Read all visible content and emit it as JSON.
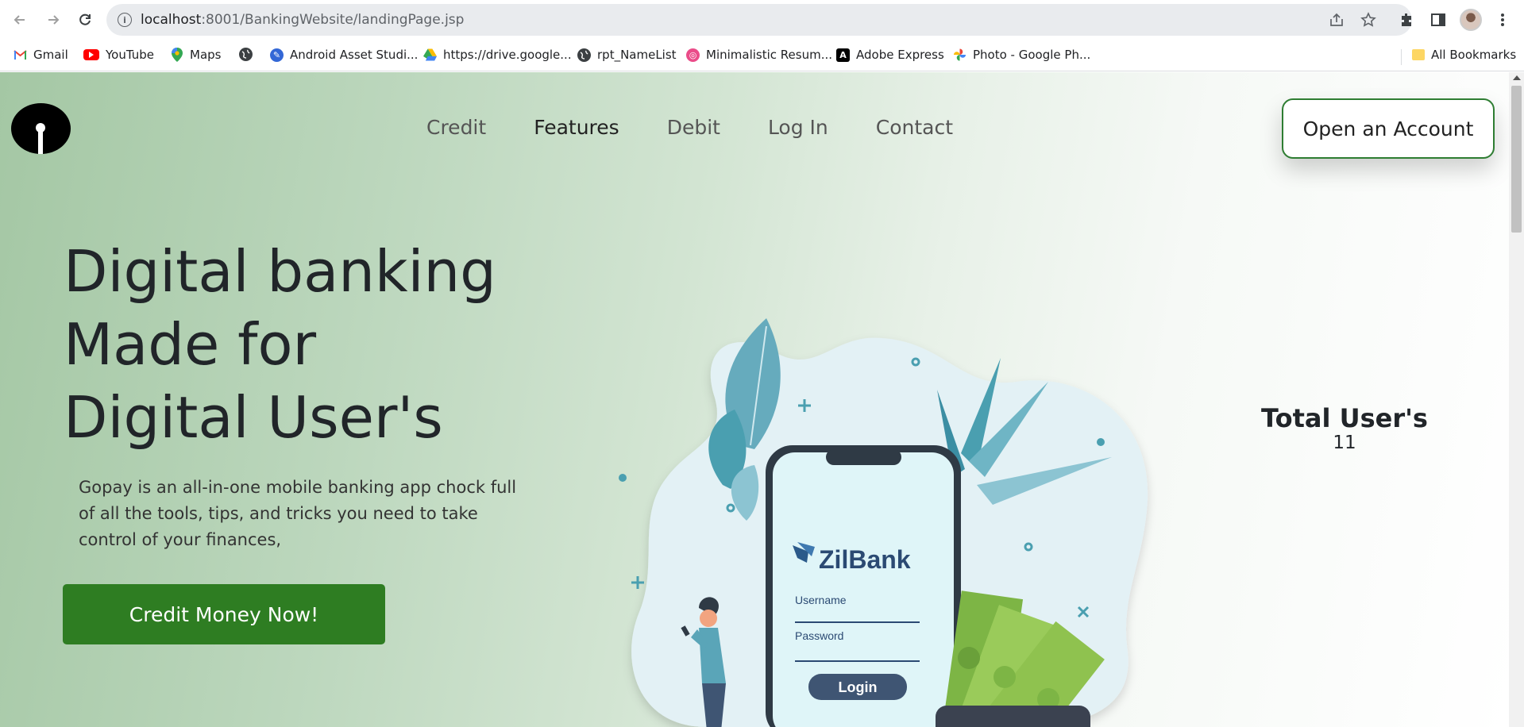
{
  "browser": {
    "url_host": "localhost",
    "url_rest": ":8001/BankingWebsite/landingPage.jsp",
    "bookmarks": [
      {
        "label": "Gmail",
        "icon": "gmail-icon",
        "color": "#ea4335"
      },
      {
        "label": "YouTube",
        "icon": "youtube-icon",
        "color": "#ff0000"
      },
      {
        "label": "Maps",
        "icon": "maps-icon",
        "color": "#34a853"
      },
      {
        "label": "",
        "icon": "globe-icon",
        "color": "#3c4043"
      },
      {
        "label": "Android Asset Studi...",
        "icon": "android-asset-studio-icon",
        "color": "#3367d6"
      },
      {
        "label": "https://drive.google...",
        "icon": "google-drive-icon",
        "color": "#fbbc04"
      },
      {
        "label": "rpt_NameList",
        "icon": "globe-icon",
        "color": "#3c4043"
      },
      {
        "label": "Minimalistic Resum...",
        "icon": "dribbble-icon",
        "color": "#ea4c89"
      },
      {
        "label": "Adobe Express",
        "icon": "adobe-express-icon",
        "color": "#000000"
      },
      {
        "label": "Photo - Google Ph...",
        "icon": "google-photos-icon",
        "color": "#fbbc04"
      }
    ],
    "all_bookmarks": "All Bookmarks"
  },
  "nav": {
    "links": [
      "Credit",
      "Features",
      "Debit",
      "Log In",
      "Contact"
    ],
    "active": "Features",
    "open_account": "Open an Account"
  },
  "hero": {
    "title_lines": [
      "Digital banking",
      "Made for",
      "Digital User's"
    ],
    "description": "Gopay is an all-in-one mobile banking app chock full of all the tools, tips, and tricks you need to take control of your finances,",
    "cta": "Credit Money Now!"
  },
  "illustration": {
    "brand": "ZilBank",
    "username_label": "Username",
    "password_label": "Password",
    "login_label": "Login"
  },
  "stats": {
    "title": "Total User's",
    "count": "11"
  },
  "colors": {
    "accent_green": "#2e7d22",
    "teal": "#4a9fb0"
  }
}
